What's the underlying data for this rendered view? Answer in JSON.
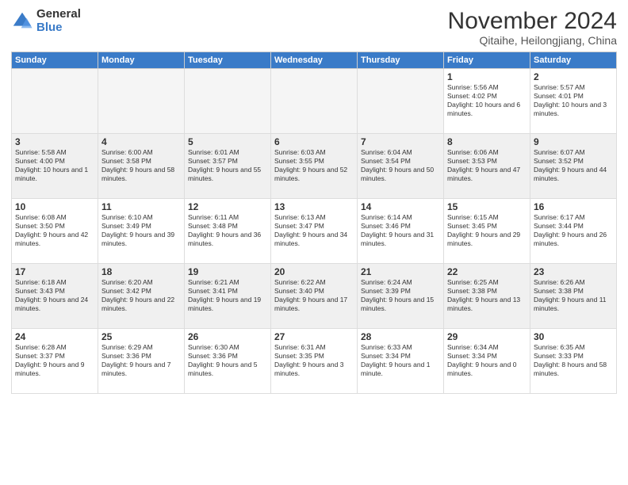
{
  "logo": {
    "general": "General",
    "blue": "Blue"
  },
  "title": "November 2024",
  "subtitle": "Qitaihe, Heilongjiang, China",
  "headers": [
    "Sunday",
    "Monday",
    "Tuesday",
    "Wednesday",
    "Thursday",
    "Friday",
    "Saturday"
  ],
  "weeks": [
    [
      {
        "day": "",
        "info": ""
      },
      {
        "day": "",
        "info": ""
      },
      {
        "day": "",
        "info": ""
      },
      {
        "day": "",
        "info": ""
      },
      {
        "day": "",
        "info": ""
      },
      {
        "day": "1",
        "info": "Sunrise: 5:56 AM\nSunset: 4:02 PM\nDaylight: 10 hours and 6 minutes."
      },
      {
        "day": "2",
        "info": "Sunrise: 5:57 AM\nSunset: 4:01 PM\nDaylight: 10 hours and 3 minutes."
      }
    ],
    [
      {
        "day": "3",
        "info": "Sunrise: 5:58 AM\nSunset: 4:00 PM\nDaylight: 10 hours and 1 minute."
      },
      {
        "day": "4",
        "info": "Sunrise: 6:00 AM\nSunset: 3:58 PM\nDaylight: 9 hours and 58 minutes."
      },
      {
        "day": "5",
        "info": "Sunrise: 6:01 AM\nSunset: 3:57 PM\nDaylight: 9 hours and 55 minutes."
      },
      {
        "day": "6",
        "info": "Sunrise: 6:03 AM\nSunset: 3:55 PM\nDaylight: 9 hours and 52 minutes."
      },
      {
        "day": "7",
        "info": "Sunrise: 6:04 AM\nSunset: 3:54 PM\nDaylight: 9 hours and 50 minutes."
      },
      {
        "day": "8",
        "info": "Sunrise: 6:06 AM\nSunset: 3:53 PM\nDaylight: 9 hours and 47 minutes."
      },
      {
        "day": "9",
        "info": "Sunrise: 6:07 AM\nSunset: 3:52 PM\nDaylight: 9 hours and 44 minutes."
      }
    ],
    [
      {
        "day": "10",
        "info": "Sunrise: 6:08 AM\nSunset: 3:50 PM\nDaylight: 9 hours and 42 minutes."
      },
      {
        "day": "11",
        "info": "Sunrise: 6:10 AM\nSunset: 3:49 PM\nDaylight: 9 hours and 39 minutes."
      },
      {
        "day": "12",
        "info": "Sunrise: 6:11 AM\nSunset: 3:48 PM\nDaylight: 9 hours and 36 minutes."
      },
      {
        "day": "13",
        "info": "Sunrise: 6:13 AM\nSunset: 3:47 PM\nDaylight: 9 hours and 34 minutes."
      },
      {
        "day": "14",
        "info": "Sunrise: 6:14 AM\nSunset: 3:46 PM\nDaylight: 9 hours and 31 minutes."
      },
      {
        "day": "15",
        "info": "Sunrise: 6:15 AM\nSunset: 3:45 PM\nDaylight: 9 hours and 29 minutes."
      },
      {
        "day": "16",
        "info": "Sunrise: 6:17 AM\nSunset: 3:44 PM\nDaylight: 9 hours and 26 minutes."
      }
    ],
    [
      {
        "day": "17",
        "info": "Sunrise: 6:18 AM\nSunset: 3:43 PM\nDaylight: 9 hours and 24 minutes."
      },
      {
        "day": "18",
        "info": "Sunrise: 6:20 AM\nSunset: 3:42 PM\nDaylight: 9 hours and 22 minutes."
      },
      {
        "day": "19",
        "info": "Sunrise: 6:21 AM\nSunset: 3:41 PM\nDaylight: 9 hours and 19 minutes."
      },
      {
        "day": "20",
        "info": "Sunrise: 6:22 AM\nSunset: 3:40 PM\nDaylight: 9 hours and 17 minutes."
      },
      {
        "day": "21",
        "info": "Sunrise: 6:24 AM\nSunset: 3:39 PM\nDaylight: 9 hours and 15 minutes."
      },
      {
        "day": "22",
        "info": "Sunrise: 6:25 AM\nSunset: 3:38 PM\nDaylight: 9 hours and 13 minutes."
      },
      {
        "day": "23",
        "info": "Sunrise: 6:26 AM\nSunset: 3:38 PM\nDaylight: 9 hours and 11 minutes."
      }
    ],
    [
      {
        "day": "24",
        "info": "Sunrise: 6:28 AM\nSunset: 3:37 PM\nDaylight: 9 hours and 9 minutes."
      },
      {
        "day": "25",
        "info": "Sunrise: 6:29 AM\nSunset: 3:36 PM\nDaylight: 9 hours and 7 minutes."
      },
      {
        "day": "26",
        "info": "Sunrise: 6:30 AM\nSunset: 3:36 PM\nDaylight: 9 hours and 5 minutes."
      },
      {
        "day": "27",
        "info": "Sunrise: 6:31 AM\nSunset: 3:35 PM\nDaylight: 9 hours and 3 minutes."
      },
      {
        "day": "28",
        "info": "Sunrise: 6:33 AM\nSunset: 3:34 PM\nDaylight: 9 hours and 1 minute."
      },
      {
        "day": "29",
        "info": "Sunrise: 6:34 AM\nSunset: 3:34 PM\nDaylight: 9 hours and 0 minutes."
      },
      {
        "day": "30",
        "info": "Sunrise: 6:35 AM\nSunset: 3:33 PM\nDaylight: 8 hours and 58 minutes."
      }
    ]
  ]
}
